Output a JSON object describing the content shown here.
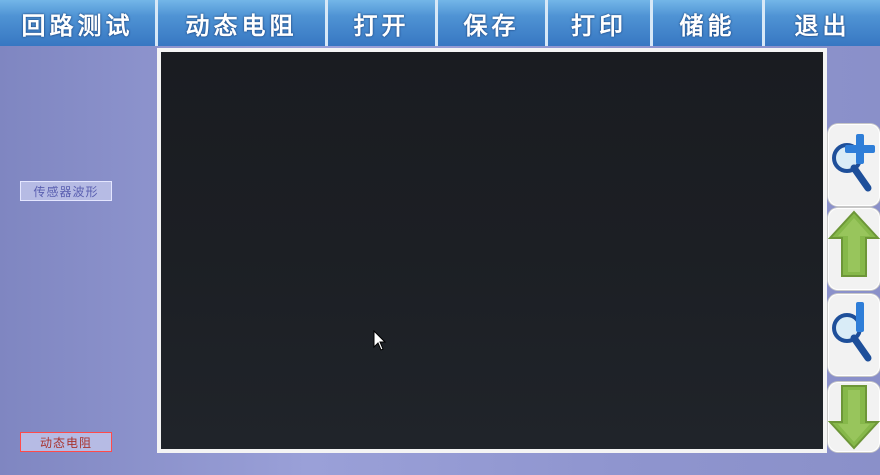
{
  "menubar": {
    "items": [
      {
        "label": "回路测试"
      },
      {
        "label": "动态电阻"
      },
      {
        "label": "打开"
      },
      {
        "label": "保存"
      },
      {
        "label": "打印"
      },
      {
        "label": "储能"
      },
      {
        "label": "退出"
      }
    ]
  },
  "left_panel": {
    "sensor_waveform_label": "传感器波形",
    "dynamic_resistance_label": "动态电阻"
  },
  "tools": {
    "items": [
      {
        "icon": "zoom-in-icon"
      },
      {
        "icon": "arrow-up-icon"
      },
      {
        "icon": "zoom-out-icon"
      },
      {
        "icon": "arrow-down-icon"
      }
    ]
  },
  "colors": {
    "menu_blue": "#4f93d4",
    "canvas_black": "#1c1f24",
    "label_red_border": "#ff4a4a",
    "arrow_green": "#86b84a"
  }
}
